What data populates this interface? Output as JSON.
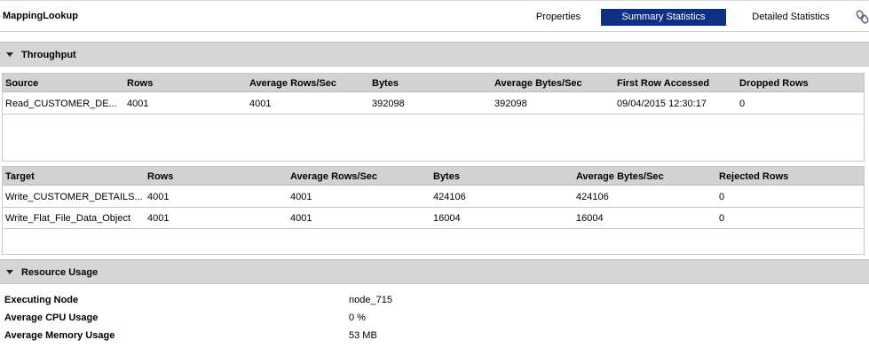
{
  "header": {
    "title": "MappingLookup",
    "tabs": {
      "properties": "Properties",
      "summary": "Summary Statistics",
      "detailed": "Detailed Statistics"
    },
    "link_icon": "link-chain-icon"
  },
  "throughput": {
    "title": "Throughput",
    "source_table": {
      "columns": [
        "Source",
        "Rows",
        "Average Rows/Sec",
        "Bytes",
        "Average Bytes/Sec",
        "First Row Accessed",
        "Dropped Rows"
      ],
      "rows": [
        [
          "Read_CUSTOMER_DE...",
          "4001",
          "4001",
          "392098",
          "392098",
          "09/04/2015 12:30:17",
          "0"
        ]
      ]
    },
    "target_table": {
      "columns": [
        "Target",
        "Rows",
        "Average Rows/Sec",
        "Bytes",
        "Average Bytes/Sec",
        "Rejected Rows"
      ],
      "rows": [
        [
          "Write_CUSTOMER_DETAILS...",
          "4001",
          "4001",
          "424106",
          "424106",
          "0"
        ],
        [
          "Write_Flat_File_Data_Object",
          "4001",
          "4001",
          "16004",
          "16004",
          "0"
        ]
      ]
    }
  },
  "resource_usage": {
    "title": "Resource Usage",
    "executing_node_label": "Executing Node",
    "executing_node_value": "node_715",
    "cpu_label": "Average CPU Usage",
    "cpu_value": "0 %",
    "memory_label": "Average Memory Usage",
    "memory_value": "53 MB"
  },
  "colors": {
    "active_tab": "#0d2f86",
    "section_header": "#d6d6d6",
    "table_header": "#d2d2d2"
  }
}
